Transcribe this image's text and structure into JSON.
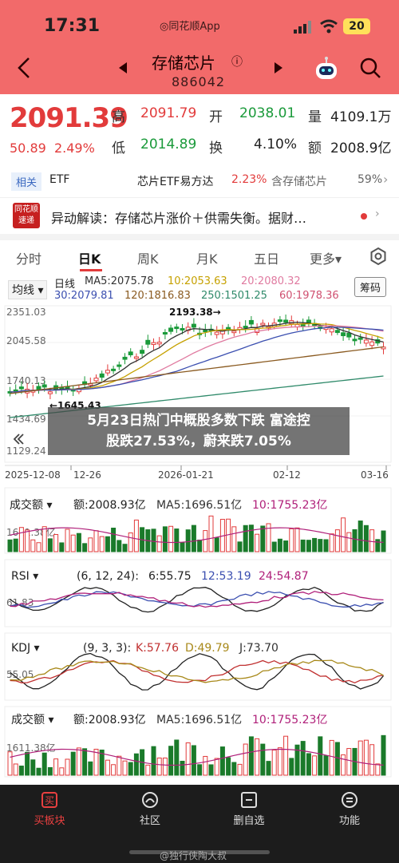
{
  "status": {
    "time": "17:31",
    "source_app": "◎同花顺App",
    "battery": "20"
  },
  "nav": {
    "stock_name": "存储芯片",
    "stock_code": "886042",
    "info_icon": "ⓘ"
  },
  "quote": {
    "price": "2091.39",
    "change": "50.89",
    "change_pct": "2.49%",
    "fields": [
      {
        "label": "高",
        "value": "2091.79",
        "color": "red"
      },
      {
        "label": "开",
        "value": "2038.01",
        "color": "green"
      },
      {
        "label": "量",
        "value": "4109.1万",
        "color": "dark"
      },
      {
        "label": "低",
        "value": "2014.89",
        "color": "green"
      },
      {
        "label": "换",
        "value": "4.10%",
        "color": "dark"
      },
      {
        "label": "额",
        "value": "2008.9亿",
        "color": "dark"
      }
    ]
  },
  "tags": {
    "badge": "相关",
    "etf": "ETF",
    "etf_name": "芯片ETF易方达",
    "etf_pct": "2.23%",
    "etf2_name": "含存储芯片",
    "etf2_pct": "59%",
    "arrow": "›"
  },
  "news": {
    "logo_line1": "同花顺",
    "logo_line2": "速递",
    "text": "异动解读：存储芯片涨价＋供需失衡。据财…",
    "more": "›"
  },
  "tabs": [
    {
      "label": "分时",
      "active": false
    },
    {
      "label": "日K",
      "active": true
    },
    {
      "label": "周K",
      "active": false
    },
    {
      "label": "月K",
      "active": false
    },
    {
      "label": "五日",
      "active": false
    },
    {
      "label": "更多▾",
      "active": false
    }
  ],
  "main_chart": {
    "indicator_badge": "均线 ▾",
    "rights_button": "筹码",
    "legend_line1": {
      "title": "日线",
      "ma5": "MA5:2075.78",
      "ma10": "10:2053.63",
      "ma20": "20:2080.32"
    },
    "legend_line2": {
      "ma30": "30:2079.81",
      "ma120": "120:1816.83",
      "ma250": "250:1501.25",
      "ma60": "60:1978.36"
    },
    "y_ticks": [
      "2351.03",
      "2045.58",
      "1740.13",
      "1434.69",
      "1129.24"
    ],
    "high_label": "2193.38→",
    "low_label": "←1645.43",
    "x_ticks": [
      "2025-12-08",
      "12-26",
      "2026-01-21",
      "02-12",
      "03-16"
    ]
  },
  "overlay": {
    "line1": "5月23日热门中概股多数下跌 富途控",
    "line2": "股跌27.53%，蔚来跌7.05%"
  },
  "volume_panel": {
    "name": "成交额 ▾",
    "amount": "额:2008.93亿",
    "ma5": "MA5:1696.51亿",
    "ma10": "10:1755.23亿",
    "level": "1611.38亿"
  },
  "rsi_panel": {
    "name": "RSI ▾",
    "params": "(6, 12, 24):",
    "v6": "6:55.75",
    "v12": "12:53.19",
    "v24": "24:54.87",
    "level": "61.83"
  },
  "kdj_panel": {
    "name": "KDJ ▾",
    "params": "(9, 3, 3):",
    "k": "K:57.76",
    "d": "D:49.79",
    "j": "J:73.70",
    "level": "55.05"
  },
  "volume_panel2": {
    "name": "成交额 ▾",
    "amount": "额:2008.93亿",
    "ma5": "MA5:1696.51亿",
    "ma10": "10:1755.23亿",
    "level": "1611.38亿"
  },
  "bottom_nav": [
    {
      "label": "买板块",
      "icon": "buy-icon",
      "active": true
    },
    {
      "label": "社区",
      "icon": "community-icon",
      "active": false
    },
    {
      "label": "删自选",
      "icon": "remove-watchlist-icon",
      "active": false
    },
    {
      "label": "功能",
      "icon": "function-icon",
      "active": false
    }
  ],
  "watermark": "@独行侠陶大叔",
  "colors": {
    "up": "#e23b3b",
    "down": "#1a9a3a",
    "header": "#f26a6a"
  }
}
